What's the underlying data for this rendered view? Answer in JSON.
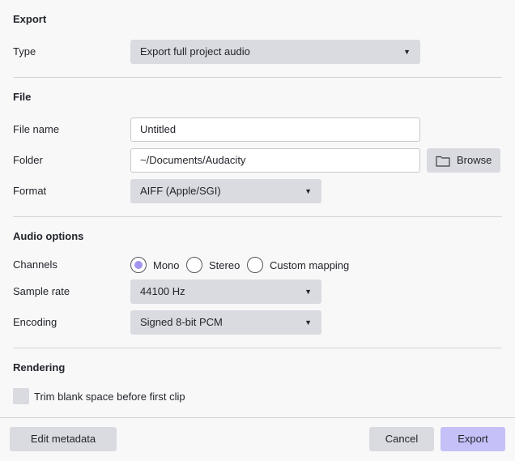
{
  "export": {
    "title": "Export",
    "type_label": "Type",
    "type_value": "Export full project audio"
  },
  "file": {
    "title": "File",
    "name_label": "File name",
    "name_value": "Untitled",
    "folder_label": "Folder",
    "folder_value": "~/Documents/Audacity",
    "browse_label": "Browse",
    "format_label": "Format",
    "format_value": "AIFF (Apple/SGI)"
  },
  "audio": {
    "title": "Audio options",
    "channels_label": "Channels",
    "channels": [
      {
        "label": "Mono",
        "checked": true
      },
      {
        "label": "Stereo",
        "checked": false
      },
      {
        "label": "Custom mapping",
        "checked": false
      }
    ],
    "sample_rate_label": "Sample rate",
    "sample_rate_value": "44100 Hz",
    "encoding_label": "Encoding",
    "encoding_value": "Signed 8-bit PCM"
  },
  "rendering": {
    "title": "Rendering",
    "trim_label": "Trim blank space before first clip",
    "trim_checked": false
  },
  "footer": {
    "edit_metadata_label": "Edit metadata",
    "cancel_label": "Cancel",
    "export_label": "Export"
  },
  "colors": {
    "accent": "#a394ef",
    "primary_button": "#c5c0f7",
    "control": "#dadbe1"
  },
  "icons": {
    "caret": "caret-down-icon",
    "folder": "folder-icon"
  }
}
